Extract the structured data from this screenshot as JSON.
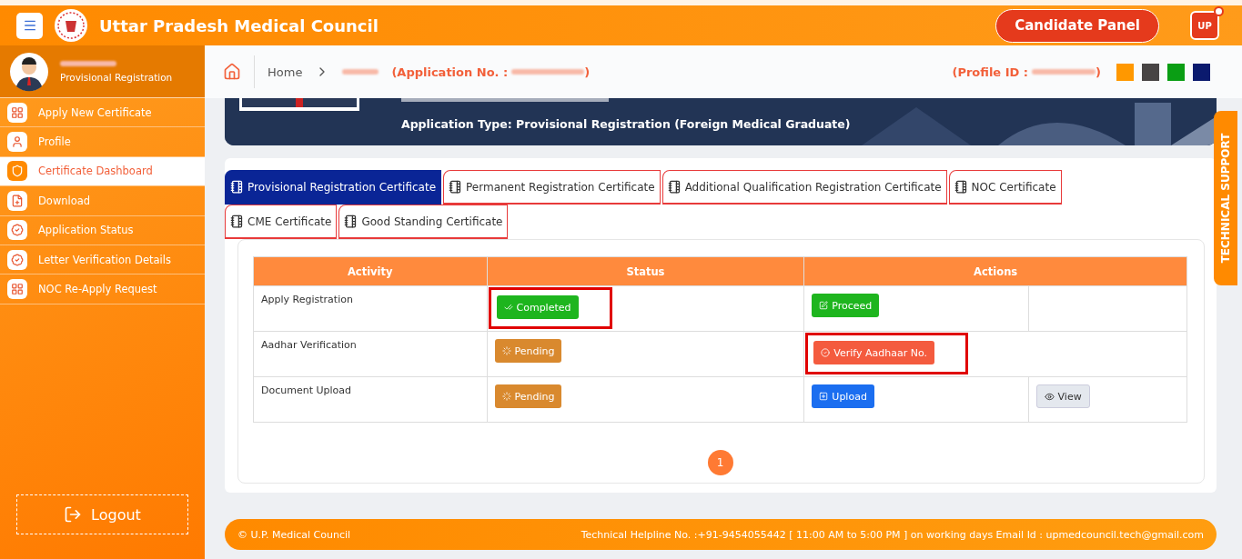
{
  "header": {
    "title": "Uttar Pradesh Medical Council",
    "panel_button": "Candidate Panel",
    "user_badge": "UP",
    "notification": true
  },
  "sidebar": {
    "role": "Provisional Registration",
    "items": [
      {
        "label": "Apply New Certificate",
        "kind": "grid",
        "selected": false
      },
      {
        "label": "Profile",
        "kind": "user",
        "selected": false
      },
      {
        "label": "Certificate Dashboard",
        "kind": "shield",
        "selected": true
      },
      {
        "label": "Download",
        "kind": "file",
        "selected": false
      },
      {
        "label": "Application Status",
        "kind": "badge",
        "selected": false
      },
      {
        "label": "Letter Verification Details",
        "kind": "badge",
        "selected": false
      },
      {
        "label": "NOC Re-Apply Request",
        "kind": "grid",
        "selected": false
      }
    ],
    "logout": "Logout"
  },
  "breadcrumb": {
    "home": "Home",
    "application_prefix": "(Application No. :",
    "application_suffix": ")",
    "profile_prefix": "(Profile ID :",
    "profile_suffix": ")",
    "swatches": [
      {
        "color": "#ff9800"
      },
      {
        "color": "#474444"
      },
      {
        "color": "#0a9e14"
      },
      {
        "color": "#0b1a6e"
      }
    ]
  },
  "banner": {
    "application_type": "Application Type: Provisional Registration (Foreign Medical Graduate)"
  },
  "technical_support": "TECHNICAL SUPPORT",
  "tabs": [
    {
      "label": "Provisional Registration Certificate",
      "selected": true
    },
    {
      "label": "Permanent Registration Certificate",
      "selected": false
    },
    {
      "label": "Additional Qualification Registration Certificate",
      "selected": false
    },
    {
      "label": "NOC Certificate",
      "selected": false
    },
    {
      "label": "CME Certificate",
      "selected": false
    },
    {
      "label": "Good Standing Certificate",
      "selected": false
    }
  ],
  "table": {
    "columns": [
      "Activity",
      "Status",
      "Actions"
    ],
    "rows": [
      {
        "activity": "Apply Registration",
        "status": {
          "label": "Completed",
          "kind": "completed",
          "highlighted": true
        },
        "action": {
          "label": "Proceed",
          "kind": "proceed",
          "highlighted": false
        }
      },
      {
        "activity": "Aadhar Verification",
        "status": {
          "label": "Pending",
          "kind": "pending",
          "highlighted": false
        },
        "action": {
          "label": "Verify Aadhaar No.",
          "kind": "verify",
          "highlighted": true
        }
      },
      {
        "activity": "Document Upload",
        "status": {
          "label": "Pending",
          "kind": "pending",
          "highlighted": false
        },
        "action": {
          "label": "Upload",
          "kind": "upload",
          "highlighted": false
        },
        "extra": {
          "label": "View"
        }
      }
    ]
  },
  "pagination": [
    {
      "label": "1",
      "selected": true
    }
  ],
  "footer": {
    "copyright": "© U.P. Medical Council",
    "contact": "Technical Helpline No. :+91-9454055442 [ 11:00 AM to 5:00 PM ] on working days  Email Id : upmedcouncil.tech@gmail.com"
  }
}
